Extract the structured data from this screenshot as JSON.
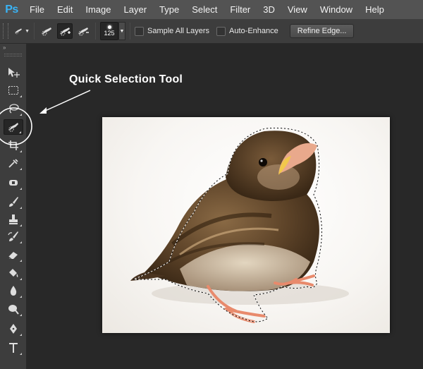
{
  "app": {
    "logo": "Ps"
  },
  "menu": {
    "items": [
      "File",
      "Edit",
      "Image",
      "Layer",
      "Type",
      "Select",
      "Filter",
      "3D",
      "View",
      "Window",
      "Help"
    ]
  },
  "options": {
    "brush_size": "125",
    "sample_all_layers": {
      "label": "Sample All Layers",
      "checked": false
    },
    "auto_enhance": {
      "label": "Auto-Enhance",
      "checked": false
    },
    "refine_edge_label": "Refine Edge..."
  },
  "toolbar": {
    "collapse_glyph": "»",
    "active_tool": "quick-selection",
    "tools": [
      "move",
      "rectangular-marquee",
      "lasso",
      "quick-selection",
      "crop",
      "eyedropper",
      "spot-healing-brush",
      "brush",
      "clone-stamp",
      "history-brush",
      "eraser",
      "paint-bucket",
      "blur",
      "dodge",
      "pen",
      "type"
    ]
  },
  "annotation": {
    "text": "Quick Selection Tool"
  },
  "colors": {
    "accent": "#3ab3f5",
    "menubar": "#535353",
    "panel": "#3d3d3d",
    "workspace": "#282828"
  }
}
